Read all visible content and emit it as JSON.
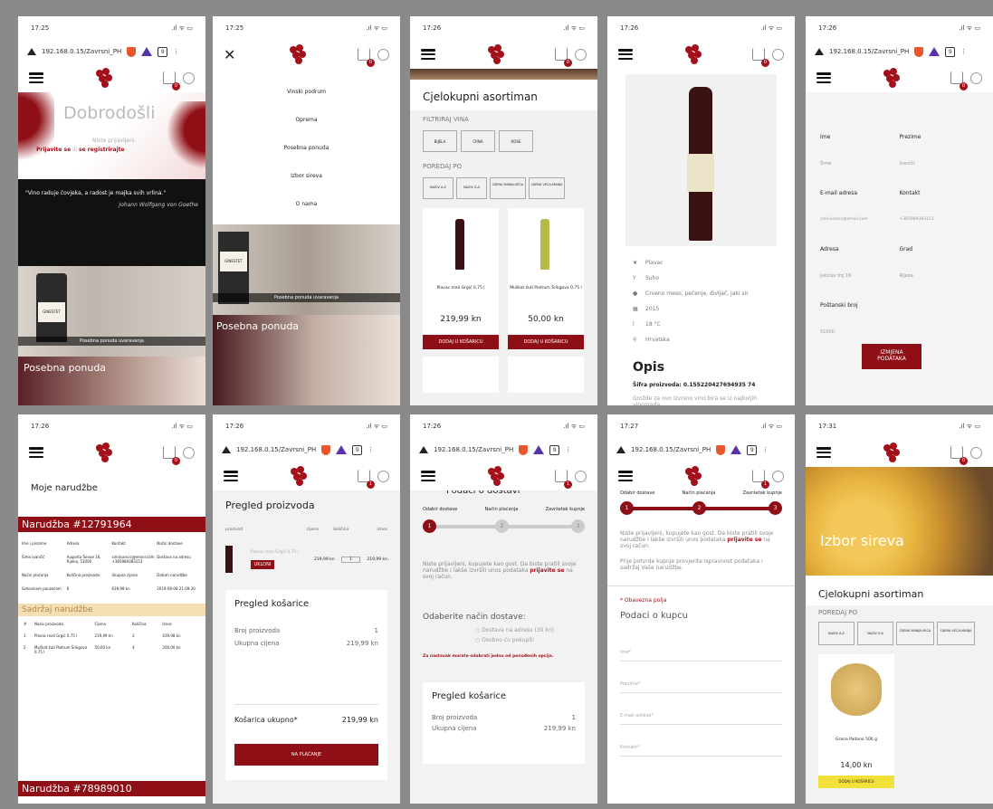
{
  "screens": {
    "s1": {
      "time": "17:25",
      "url": "192.168.0.15/Zavrsni_PH",
      "tabs": "9",
      "cart": "0",
      "welcome": "Dobrodošli",
      "notlogged": "Niste prijavljeni.",
      "login": "Prijavite se",
      "or": "ili",
      "register": "se registrirajte",
      "quote": "\"Vino raduje čovjeka, a radost je majka svih vrlina.\"",
      "quote_author": "Johann Wolfgang von Goethe",
      "caption": "Posebna ponuda uvaravanja",
      "special": "Posebna ponuda"
    },
    "s2": {
      "time": "17:25",
      "cart": "0",
      "menu": [
        "Vinski podrum",
        "Oprema",
        "Posebna ponuda",
        "Izbor sireva",
        "O nama"
      ],
      "caption": "Posebna ponuda uvaravanja",
      "special": "Posebna ponuda"
    },
    "s3": {
      "time": "17:26",
      "cart": "0",
      "title": "Cjelokupni asortiman",
      "filter": "FILTRIRAJ VINA",
      "filters": [
        "BIJELA",
        "CRNA",
        "ROSE"
      ],
      "sort": "POREDAJ PO",
      "sorts": [
        "NAZIV A-Z",
        "NAZIV Z-A",
        "CIJENA MANJA-VEĆA",
        "CIJENA VEĆA-MANJA"
      ],
      "p1": {
        "name": "Plavac mali Grgić 0,75 l",
        "price": "219,99 kn",
        "btn": "DODAJ U KOŠARICU"
      },
      "p2": {
        "name": "Muškat žuti Podrum Šrikgova 0,75 l",
        "price": "50,00 kn",
        "btn": "DODAJ U KOŠARICU"
      }
    },
    "s4": {
      "time": "17:26",
      "cart": "0",
      "attrs": [
        "Plavac",
        "Suho",
        "Crveno meso, pečenje, divljač, jaki sir",
        "2015",
        "18 °C",
        "Hrvatska"
      ],
      "opis": "Opis",
      "code": "Šifra proizvoda: 0.155220427694935 74",
      "desc": "Grožđe za ovo izvrsno vino bira se iz najboljih vinograda ..."
    },
    "s5": {
      "time": "17:26",
      "url": "192.168.0.15/Zavrsni_PH",
      "tabs": "9",
      "cart": "0",
      "labels": [
        "Ime",
        "Prezime",
        "E-mail adresa",
        "Kontakt",
        "Adresa",
        "Grad",
        "Poštanski broj"
      ],
      "vals": [
        "Šime",
        "Ivančić",
        "simiivancic@email.com",
        "+385989383153",
        "Jokićev trg 16",
        "Rijeka",
        "51000"
      ],
      "btn": "IZMJENA PODATAKA"
    },
    "s6": {
      "time": "17:26",
      "cart": "0",
      "title": "Moje narudžbe",
      "order1": "Narudžba #12791964",
      "cols": [
        "Ime i prezime",
        "Adresa",
        "Kontakt",
        "Način dostave"
      ],
      "r1": [
        "Šime Ivančić",
        "Augusta Šenoe 16, Rijeka, 51000",
        "simiivancic@email.com +385989383153",
        "Dostava na adresu"
      ],
      "r2": [
        "Način plaćanja",
        "Količina proizvoda",
        "Ukupna cijena",
        "Datum narudžbe"
      ],
      "r3": [
        "Gotovinom pouzećem",
        "6",
        "639,98 kn",
        "2019-08-08 21:09:30"
      ],
      "contents": "Sadržaj narudžbe",
      "ccols": [
        "#",
        "Naziv proizvoda",
        "Cijena",
        "Količina",
        "Iznos"
      ],
      "items": [
        [
          "1",
          "Plavac mali Grgić 0,75 l",
          "219,99 kn",
          "2",
          "439,98 kn"
        ],
        [
          "2",
          "Muškat žuti Podrum Šrikgova 0,75 l",
          "50,00 kn",
          "4",
          "200,00 kn"
        ]
      ],
      "order2": "Narudžba #78989010"
    },
    "s7": {
      "time": "17:26",
      "url": "192.168.0.15/Zavrsni_PH",
      "tabs": "9",
      "cart": "1",
      "title": "Pregled proizvoda",
      "cols": [
        "proizvod",
        "cijena",
        "količina",
        "iznos"
      ],
      "pname": "Plavac mali Grgić 0,75 l",
      "price": "219,99 kn",
      "qty": "1",
      "total": "219,99 kn",
      "remove": "UKLONI",
      "cart_title": "Pregled košarice",
      "count_label": "Broj proizvoda",
      "count": "1",
      "sum_label": "Ukupna cijena",
      "sum": "219,99 kn",
      "grand_label": "Košarica ukupno*",
      "grand": "219,99 kn",
      "pay": "NA PLAĆANJE"
    },
    "s8": {
      "time": "17:26",
      "url": "192.168.0.15/Zavrsni_PH",
      "tabs": "9",
      "cart": "1",
      "title": "Podaci o dostavi",
      "steps": [
        "Odabir dostave",
        "Način plaćanja",
        "Završetak kupnje"
      ],
      "nums": [
        "1",
        "2",
        "3"
      ],
      "guest": "Niste prijavljeni, kupujete kao gost. Da biste pratili svoje narudžbe i lakše izvršili unos podataka",
      "guest_link": "prijavite se",
      "guest_end": "na svoj račun.",
      "choose": "Odaberite način dostave:",
      "opt1": "Dostava na adresu (30 kn)",
      "opt2": "Osobno ću pokupiti",
      "warn": "Za nastavak morate odabrati jednu od ponuđenih opcija.",
      "cart_title": "Pregled košarice",
      "count_label": "Broj proizvoda",
      "count": "1",
      "sum_label": "Ukupna cijena",
      "sum": "219,99 kn"
    },
    "s9": {
      "time": "17:27",
      "url": "192.168.0.15/Zavrsni_PH",
      "tabs": "9",
      "cart": "1",
      "steps": [
        "Odabir dostave",
        "Način plaćanja",
        "Završetak kupnje"
      ],
      "nums": [
        "1",
        "2",
        "3"
      ],
      "guest": "Niste prijavljeni, kupujete kao gost. Da biste pratili svoje narudžbe i lakše izvršili unos podataka",
      "guest_link": "prijavite se",
      "guest_end": "na svoj račun.",
      "check": "Prije potvrde kupnje provjerite ispravnost podataka i sadržaj Vaše narudžbe.",
      "req": "* Obavezna polja",
      "buyer": "Podaci o kupcu",
      "fields": [
        "Ime*",
        "Prezime*",
        "E-mail adresa*",
        "Kontakt*"
      ]
    },
    "s10": {
      "time": "17:31",
      "cart": "0",
      "hero": "Izbor sireva",
      "title": "Cjelokupni asortiman",
      "sort": "POREDAJ PO",
      "sorts": [
        "NAZIV A-Z",
        "NAZIV Z-A",
        "CIJENA MANJA-VEĆA",
        "CIJENA VEĆA-MANJA"
      ],
      "pname": "Grana Padano 500 g",
      "price": "14,00 kn",
      "btn": "DODAJ U KOŠARICU"
    }
  }
}
